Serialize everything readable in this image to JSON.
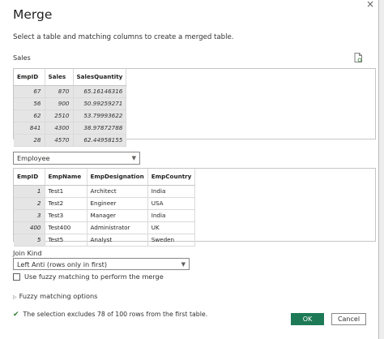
{
  "dialog": {
    "title": "Merge",
    "description": "Select a table and matching columns to create a merged table.",
    "close_glyph": "×"
  },
  "table1": {
    "label": "Sales",
    "columns": [
      "EmpID",
      "Sales",
      "SalesQuantity"
    ],
    "rows": [
      [
        "67",
        "870",
        "65.16146316"
      ],
      [
        "56",
        "900",
        "50.99259271"
      ],
      [
        "62",
        "2510",
        "53.79993622"
      ],
      [
        "841",
        "4300",
        "38.97872788"
      ],
      [
        "28",
        "4570",
        "62.44958155"
      ]
    ]
  },
  "table2": {
    "selected": "Employee",
    "columns": [
      "EmpID",
      "EmpName",
      "EmpDesignation",
      "EmpCountry"
    ],
    "rows": [
      [
        "1",
        "Test1",
        "Architect",
        "India"
      ],
      [
        "2",
        "Test2",
        "Engineer",
        "USA"
      ],
      [
        "3",
        "Test3",
        "Manager",
        "India"
      ],
      [
        "400",
        "Test400",
        "Administrator",
        "UK"
      ],
      [
        "5",
        "Test5",
        "Analyst",
        "Sweden"
      ]
    ]
  },
  "join": {
    "label": "Join Kind",
    "selected": "Left Anti (rows only in first)",
    "fuzzy_checkbox_label": "Use fuzzy matching to perform the merge",
    "fuzzy_checked": false,
    "fuzzy_options_label": "Fuzzy matching options"
  },
  "status": {
    "text": "The selection excludes 78 of 100 rows from the first table."
  },
  "buttons": {
    "ok": "OK",
    "cancel": "Cancel"
  },
  "colors": {
    "accent": "#1e7a56",
    "status_ok": "#2e7d32"
  }
}
